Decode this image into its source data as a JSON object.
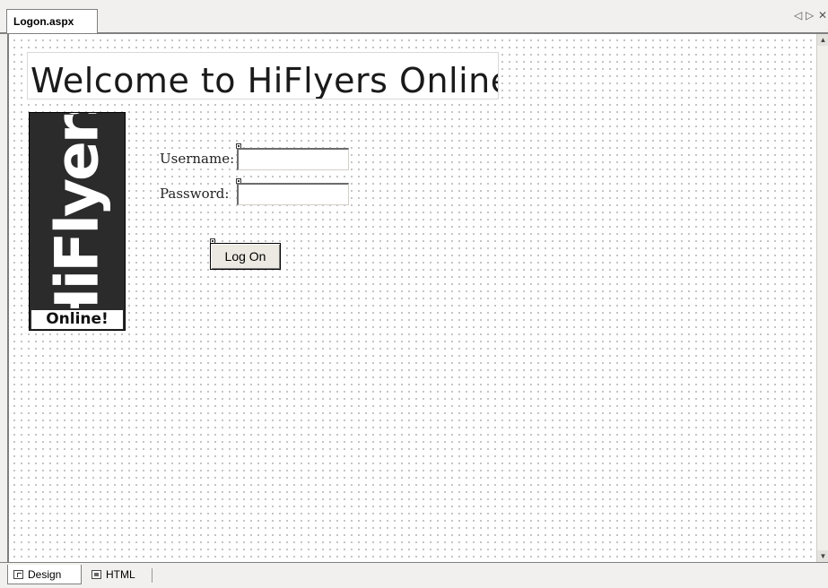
{
  "tab": {
    "title": "Logon.aspx",
    "nav_left_icon": "triangle-left-icon",
    "nav_right_icon": "triangle-right-icon",
    "close_icon": "close-icon",
    "nav_left": "◁",
    "nav_right": "▷",
    "close": "✕"
  },
  "page": {
    "heading": "Welcome to HiFlyers Online",
    "logo": {
      "main_text": "HiFlyers",
      "sub_text": "Online!"
    },
    "form": {
      "username_label": "Username:",
      "username_value": "",
      "password_label": "Password:",
      "password_value": "",
      "logon_button": "Log On"
    }
  },
  "bottom_tabs": {
    "design": "Design",
    "html": "HTML"
  },
  "scrollbar": {
    "up": "▲",
    "down": "▼"
  },
  "colors": {
    "logo_background": "#2b2b2b",
    "surface_dots": "#9c9c9c"
  }
}
